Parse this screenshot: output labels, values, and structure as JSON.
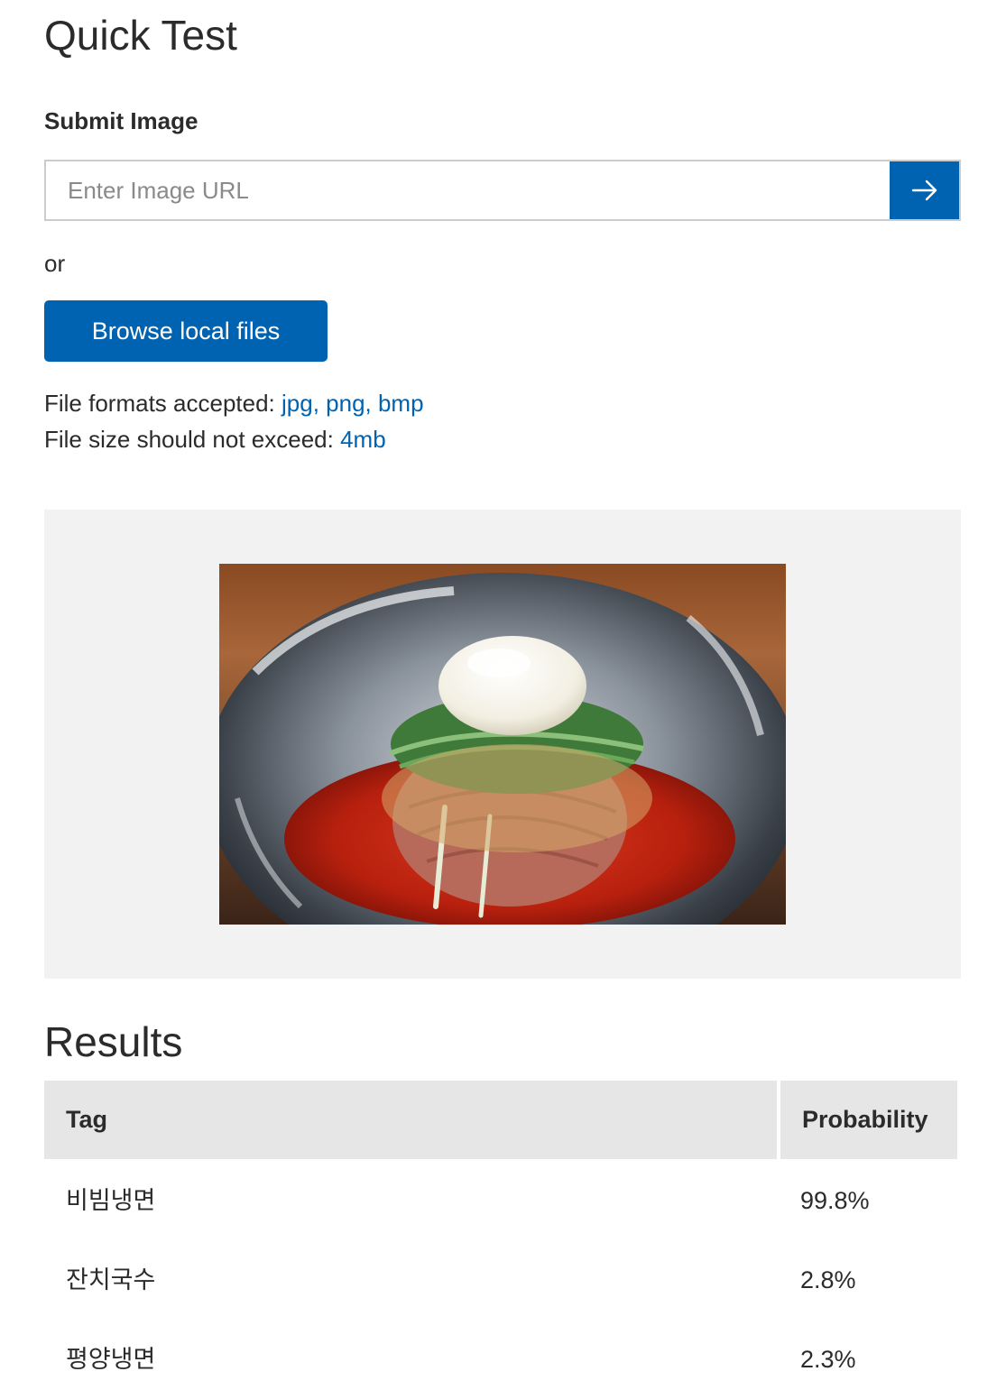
{
  "page": {
    "title": "Quick Test"
  },
  "submit": {
    "label": "Submit Image",
    "url_placeholder": "Enter Image URL",
    "url_value": "",
    "submit_icon": "arrow-right-icon",
    "or_text": "or",
    "browse_label": "Browse local files",
    "formats_label": "File formats accepted: ",
    "formats_value": "jpg, png, bmp",
    "size_label": "File size should not exceed: ",
    "size_value": "4mb"
  },
  "preview": {
    "image_subject": "bowl of spicy cold noodles with egg, cucumber and sesame"
  },
  "results": {
    "title": "Results",
    "columns": {
      "tag": "Tag",
      "probability": "Probability"
    },
    "rows": [
      {
        "tag": "비빔냉면",
        "probability": "99.8%"
      },
      {
        "tag": "잔치국수",
        "probability": "2.8%"
      },
      {
        "tag": "평양냉면",
        "probability": "2.3%"
      }
    ]
  },
  "colors": {
    "accent": "#0063b1",
    "panel_background": "#f2f2f2",
    "table_header_background": "#e6e6e6",
    "text": "#2b2b2b",
    "placeholder": "#8a8a8a"
  }
}
